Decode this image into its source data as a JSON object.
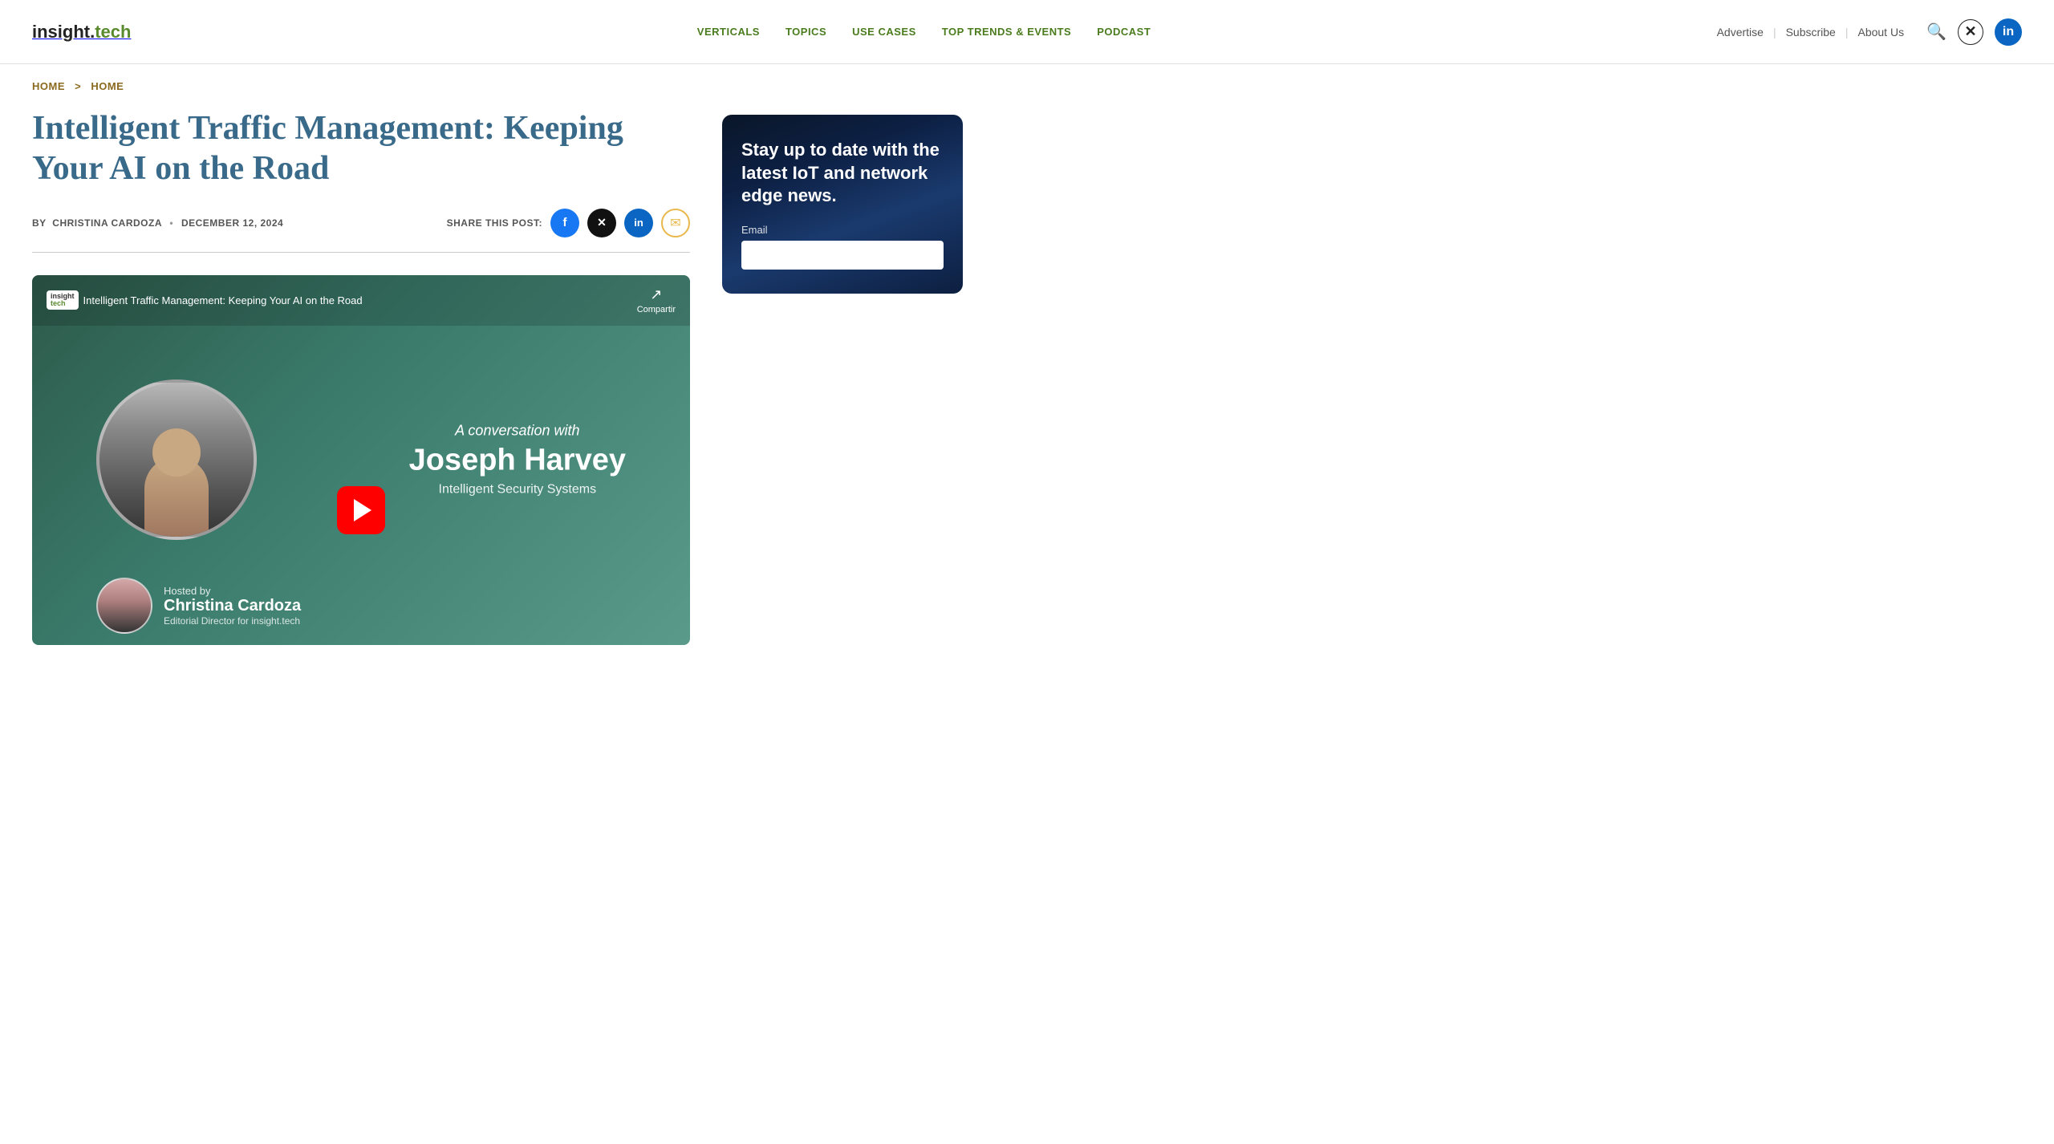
{
  "site": {
    "logo_main": "insight.",
    "logo_accent": "tech"
  },
  "nav": {
    "items": [
      {
        "label": "VERTICALS",
        "href": "#"
      },
      {
        "label": "TOPICS",
        "href": "#"
      },
      {
        "label": "USE CASES",
        "href": "#"
      },
      {
        "label": "TOP TRENDS & EVENTS",
        "href": "#"
      },
      {
        "label": "PODCAST",
        "href": "#"
      }
    ]
  },
  "header_links": {
    "advertise": "Advertise",
    "subscribe": "Subscribe",
    "about_us": "About Us"
  },
  "breadcrumb": {
    "home1": "HOME",
    "sep": ">",
    "home2": "HOME"
  },
  "article": {
    "title": "Intelligent Traffic Management: Keeping Your AI on the Road",
    "author_prefix": "BY",
    "author": "CHRISTINA CARDOZA",
    "date_sep": "•",
    "date": "DECEMBER 12, 2024",
    "share_label": "SHARE THIS POST:"
  },
  "video": {
    "logo_text1": "insight",
    "logo_text2": "tech",
    "title": "Intelligent Traffic Management: Keeping Your AI on the Road",
    "share_text": "Compartir",
    "conversation_with": "A conversation with",
    "guest_name": "Joseph Harvey",
    "guest_company": "Intelligent Security Systems",
    "hosted_by": "Hosted by",
    "host_name": "Christina Cardoza",
    "host_title": "Editorial Director for insight.tech"
  },
  "sidebar": {
    "newsletter_title": "Stay up to date with the latest IoT and network edge news.",
    "email_label": "Email",
    "email_placeholder": ""
  },
  "share_icons": {
    "facebook": "f",
    "twitter_x": "𝕏",
    "linkedin": "in",
    "email": "✉"
  }
}
